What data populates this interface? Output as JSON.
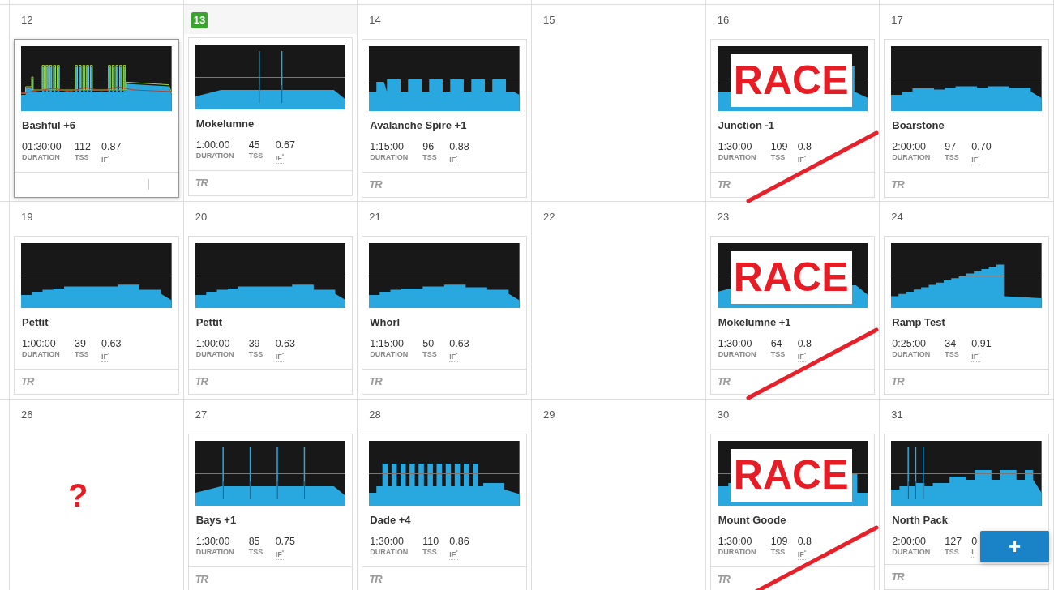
{
  "weeks": [
    {
      "days": [
        {
          "day": "12",
          "today": false,
          "race": false,
          "workout": {
            "title": "Bashful +6",
            "selected": true,
            "stats": [
              {
                "value": "01:30:00",
                "label": "DURATION"
              },
              {
                "value": "112",
                "label": "TSS"
              },
              {
                "value": "0.87",
                "label": "IF$^{*}$"
              }
            ]
          }
        },
        {
          "day": "13",
          "today": true,
          "race": false,
          "workout": {
            "title": "Mokelumne",
            "selected": false,
            "brand": "TR",
            "stats": [
              {
                "value": "1:00:00",
                "label": "DURATION"
              },
              {
                "value": "45",
                "label": "TSS"
              },
              {
                "value": "0.67",
                "label": "IF$^{*}$"
              }
            ]
          }
        },
        {
          "day": "14",
          "today": false,
          "race": false,
          "workout": {
            "title": "Avalanche Spire +1",
            "selected": false,
            "brand": "TR",
            "stats": [
              {
                "value": "1:15:00",
                "label": "DURATION"
              },
              {
                "value": "96",
                "label": "TSS"
              },
              {
                "value": "0.88",
                "label": "IF$^{*}$"
              }
            ]
          }
        },
        {
          "day": "15",
          "today": false,
          "race": false
        },
        {
          "day": "16",
          "today": false,
          "race": true,
          "race_label": "RACE",
          "workout": {
            "title": "Junction -1",
            "selected": false,
            "brand": "TR",
            "stats": [
              {
                "value": "1:30:00",
                "label": "DURATION"
              },
              {
                "value": "109",
                "label": "TSS"
              },
              {
                "value": "0.8",
                "label": "IF$^{*}$"
              }
            ]
          }
        },
        {
          "day": "17",
          "today": false,
          "race": false,
          "workout": {
            "title": "Boarstone",
            "selected": false,
            "brand": "TR",
            "stats": [
              {
                "value": "2:00:00",
                "label": "DURATION"
              },
              {
                "value": "97",
                "label": "TSS"
              },
              {
                "value": "0.70",
                "label": "IF$^{*}$"
              }
            ]
          }
        }
      ]
    },
    {
      "days": [
        {
          "day": "19",
          "today": false,
          "race": false,
          "workout": {
            "title": "Pettit",
            "selected": false,
            "brand": "TR",
            "stats": [
              {
                "value": "1:00:00",
                "label": "DURATION"
              },
              {
                "value": "39",
                "label": "TSS"
              },
              {
                "value": "0.63",
                "label": "IF$^{*}$"
              }
            ]
          }
        },
        {
          "day": "20",
          "today": false,
          "race": false,
          "workout": {
            "title": "Pettit",
            "selected": false,
            "brand": "TR",
            "stats": [
              {
                "value": "1:00:00",
                "label": "DURATION"
              },
              {
                "value": "39",
                "label": "TSS"
              },
              {
                "value": "0.63",
                "label": "IF$^{*}$"
              }
            ]
          }
        },
        {
          "day": "21",
          "today": false,
          "race": false,
          "workout": {
            "title": "Whorl",
            "selected": false,
            "brand": "TR",
            "stats": [
              {
                "value": "1:15:00",
                "label": "DURATION"
              },
              {
                "value": "50",
                "label": "TSS"
              },
              {
                "value": "0.63",
                "label": "IF$^{*}$"
              }
            ]
          }
        },
        {
          "day": "22",
          "today": false,
          "race": false
        },
        {
          "day": "23",
          "today": false,
          "race": true,
          "race_label": "RACE",
          "workout": {
            "title": "Mokelumne +1",
            "selected": false,
            "brand": "TR",
            "stats": [
              {
                "value": "1:30:00",
                "label": "DURATION"
              },
              {
                "value": "64",
                "label": "TSS"
              },
              {
                "value": "0.8",
                "label": "IF$^{*}$"
              }
            ]
          }
        },
        {
          "day": "24",
          "today": false,
          "race": false,
          "workout": {
            "title": "Ramp Test",
            "selected": false,
            "brand": "TR",
            "stats": [
              {
                "value": "0:25:00",
                "label": "DURATION"
              },
              {
                "value": "34",
                "label": "TSS"
              },
              {
                "value": "0.91",
                "label": "IF$^{*}$"
              }
            ]
          }
        }
      ]
    },
    {
      "days": [
        {
          "day": "26",
          "today": false,
          "race": false,
          "note": "?"
        },
        {
          "day": "27",
          "today": false,
          "race": false,
          "workout": {
            "title": "Bays +1",
            "selected": false,
            "brand": "TR",
            "stats": [
              {
                "value": "1:30:00",
                "label": "DURATION"
              },
              {
                "value": "85",
                "label": "TSS"
              },
              {
                "value": "0.75",
                "label": "IF$^{*}$"
              }
            ]
          }
        },
        {
          "day": "28",
          "today": false,
          "race": false,
          "workout": {
            "title": "Dade +4",
            "selected": false,
            "brand": "TR",
            "stats": [
              {
                "value": "1:30:00",
                "label": "DURATION"
              },
              {
                "value": "110",
                "label": "TSS"
              },
              {
                "value": "0.86",
                "label": "IF$^{*}$"
              }
            ]
          }
        },
        {
          "day": "29",
          "today": false,
          "race": false
        },
        {
          "day": "30",
          "today": false,
          "race": true,
          "race_label": "RACE",
          "workout": {
            "title": "Mount Goode",
            "selected": false,
            "brand": "TR",
            "stats": [
              {
                "value": "1:30:00",
                "label": "DURATION"
              },
              {
                "value": "109",
                "label": "TSS"
              },
              {
                "value": "0.8",
                "label": "IF$^{*}$"
              }
            ]
          }
        },
        {
          "day": "31",
          "today": false,
          "race": false,
          "workout": {
            "title": "North Pack",
            "selected": false,
            "brand": "TR",
            "stats": [
              {
                "value": "2:00:00",
                "label": "DURATION"
              },
              {
                "value": "127",
                "label": "TSS"
              },
              {
                "value": "0",
                "label": "I"
              }
            ]
          }
        }
      ]
    }
  ],
  "add_button": {
    "label": "+"
  }
}
